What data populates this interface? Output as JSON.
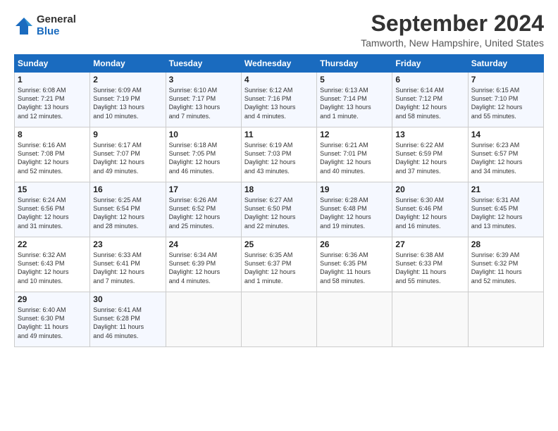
{
  "logo": {
    "general": "General",
    "blue": "Blue"
  },
  "title": "September 2024",
  "location": "Tamworth, New Hampshire, United States",
  "days_header": [
    "Sunday",
    "Monday",
    "Tuesday",
    "Wednesday",
    "Thursday",
    "Friday",
    "Saturday"
  ],
  "weeks": [
    [
      {
        "day": "1",
        "detail": "Sunrise: 6:08 AM\nSunset: 7:21 PM\nDaylight: 13 hours\nand 12 minutes."
      },
      {
        "day": "2",
        "detail": "Sunrise: 6:09 AM\nSunset: 7:19 PM\nDaylight: 13 hours\nand 10 minutes."
      },
      {
        "day": "3",
        "detail": "Sunrise: 6:10 AM\nSunset: 7:17 PM\nDaylight: 13 hours\nand 7 minutes."
      },
      {
        "day": "4",
        "detail": "Sunrise: 6:12 AM\nSunset: 7:16 PM\nDaylight: 13 hours\nand 4 minutes."
      },
      {
        "day": "5",
        "detail": "Sunrise: 6:13 AM\nSunset: 7:14 PM\nDaylight: 13 hours\nand 1 minute."
      },
      {
        "day": "6",
        "detail": "Sunrise: 6:14 AM\nSunset: 7:12 PM\nDaylight: 12 hours\nand 58 minutes."
      },
      {
        "day": "7",
        "detail": "Sunrise: 6:15 AM\nSunset: 7:10 PM\nDaylight: 12 hours\nand 55 minutes."
      }
    ],
    [
      {
        "day": "8",
        "detail": "Sunrise: 6:16 AM\nSunset: 7:08 PM\nDaylight: 12 hours\nand 52 minutes."
      },
      {
        "day": "9",
        "detail": "Sunrise: 6:17 AM\nSunset: 7:07 PM\nDaylight: 12 hours\nand 49 minutes."
      },
      {
        "day": "10",
        "detail": "Sunrise: 6:18 AM\nSunset: 7:05 PM\nDaylight: 12 hours\nand 46 minutes."
      },
      {
        "day": "11",
        "detail": "Sunrise: 6:19 AM\nSunset: 7:03 PM\nDaylight: 12 hours\nand 43 minutes."
      },
      {
        "day": "12",
        "detail": "Sunrise: 6:21 AM\nSunset: 7:01 PM\nDaylight: 12 hours\nand 40 minutes."
      },
      {
        "day": "13",
        "detail": "Sunrise: 6:22 AM\nSunset: 6:59 PM\nDaylight: 12 hours\nand 37 minutes."
      },
      {
        "day": "14",
        "detail": "Sunrise: 6:23 AM\nSunset: 6:57 PM\nDaylight: 12 hours\nand 34 minutes."
      }
    ],
    [
      {
        "day": "15",
        "detail": "Sunrise: 6:24 AM\nSunset: 6:56 PM\nDaylight: 12 hours\nand 31 minutes."
      },
      {
        "day": "16",
        "detail": "Sunrise: 6:25 AM\nSunset: 6:54 PM\nDaylight: 12 hours\nand 28 minutes."
      },
      {
        "day": "17",
        "detail": "Sunrise: 6:26 AM\nSunset: 6:52 PM\nDaylight: 12 hours\nand 25 minutes."
      },
      {
        "day": "18",
        "detail": "Sunrise: 6:27 AM\nSunset: 6:50 PM\nDaylight: 12 hours\nand 22 minutes."
      },
      {
        "day": "19",
        "detail": "Sunrise: 6:28 AM\nSunset: 6:48 PM\nDaylight: 12 hours\nand 19 minutes."
      },
      {
        "day": "20",
        "detail": "Sunrise: 6:30 AM\nSunset: 6:46 PM\nDaylight: 12 hours\nand 16 minutes."
      },
      {
        "day": "21",
        "detail": "Sunrise: 6:31 AM\nSunset: 6:45 PM\nDaylight: 12 hours\nand 13 minutes."
      }
    ],
    [
      {
        "day": "22",
        "detail": "Sunrise: 6:32 AM\nSunset: 6:43 PM\nDaylight: 12 hours\nand 10 minutes."
      },
      {
        "day": "23",
        "detail": "Sunrise: 6:33 AM\nSunset: 6:41 PM\nDaylight: 12 hours\nand 7 minutes."
      },
      {
        "day": "24",
        "detail": "Sunrise: 6:34 AM\nSunset: 6:39 PM\nDaylight: 12 hours\nand 4 minutes."
      },
      {
        "day": "25",
        "detail": "Sunrise: 6:35 AM\nSunset: 6:37 PM\nDaylight: 12 hours\nand 1 minute."
      },
      {
        "day": "26",
        "detail": "Sunrise: 6:36 AM\nSunset: 6:35 PM\nDaylight: 11 hours\nand 58 minutes."
      },
      {
        "day": "27",
        "detail": "Sunrise: 6:38 AM\nSunset: 6:33 PM\nDaylight: 11 hours\nand 55 minutes."
      },
      {
        "day": "28",
        "detail": "Sunrise: 6:39 AM\nSunset: 6:32 PM\nDaylight: 11 hours\nand 52 minutes."
      }
    ],
    [
      {
        "day": "29",
        "detail": "Sunrise: 6:40 AM\nSunset: 6:30 PM\nDaylight: 11 hours\nand 49 minutes."
      },
      {
        "day": "30",
        "detail": "Sunrise: 6:41 AM\nSunset: 6:28 PM\nDaylight: 11 hours\nand 46 minutes."
      },
      {
        "day": "",
        "detail": ""
      },
      {
        "day": "",
        "detail": ""
      },
      {
        "day": "",
        "detail": ""
      },
      {
        "day": "",
        "detail": ""
      },
      {
        "day": "",
        "detail": ""
      }
    ]
  ]
}
